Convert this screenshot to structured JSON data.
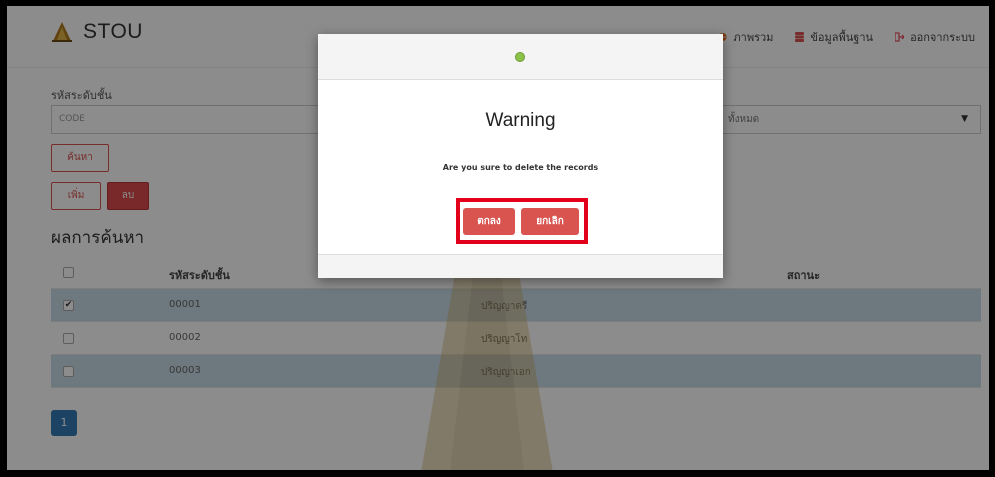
{
  "app": {
    "title": "STOU"
  },
  "nav": {
    "items": [
      {
        "label": "ภาพรวม",
        "icon": "globe-icon",
        "color": "#e66b1a"
      },
      {
        "label": "ข้อมูลพื้นฐาน",
        "icon": "database-icon",
        "color": "#d9534f"
      },
      {
        "label": "ออกจากระบบ",
        "icon": "sign-out-icon",
        "color": "#e74c5c"
      }
    ]
  },
  "search": {
    "code_label": "รหัสระดับชั้น",
    "code_placeholder": "CODE",
    "status_value": "ทั้งหมด",
    "search_button": "ค้นหา",
    "add_button": "เพิ่ม",
    "delete_button": "ลบ"
  },
  "results": {
    "title": "ผลการค้นหา",
    "headers": {
      "code": "รหัสระดับชั้น",
      "status": "สถานะ"
    },
    "rows": [
      {
        "code": "00001",
        "name": "ปริญญาตรี",
        "checked": true
      },
      {
        "code": "00002",
        "name": "ปริญญาโท",
        "checked": false
      },
      {
        "code": "00003",
        "name": "ปริญญาเอก",
        "checked": false
      }
    ]
  },
  "pagination": {
    "current": "1"
  },
  "modal": {
    "title": "Warning",
    "message": "Are you sure to delete the records",
    "ok_button": "ตกลง",
    "cancel_button": "ยกเลิก"
  },
  "colors": {
    "accent": "#d9534f",
    "highlight_row": "#c9dbe7",
    "annotation_box": "#e3001b",
    "pager": "#337ab7"
  }
}
